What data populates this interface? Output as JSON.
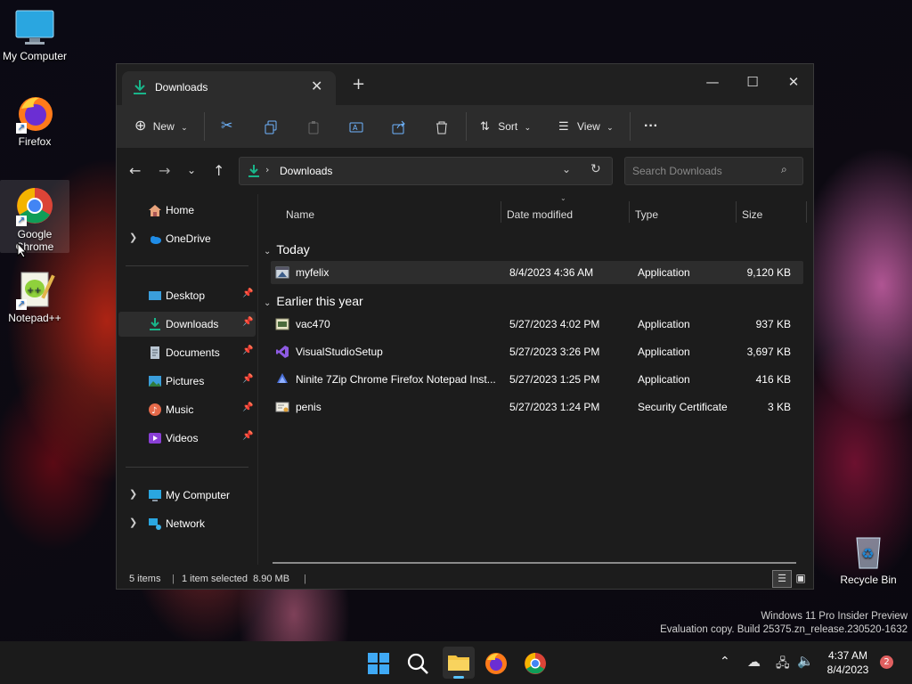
{
  "desktop": {
    "icons": [
      {
        "label": "My Computer"
      },
      {
        "label": "Firefox"
      },
      {
        "label": "Google Chrome"
      },
      {
        "label": "Notepad++"
      },
      {
        "label": "Recycle Bin"
      }
    ],
    "watermark_line1": "Windows 11 Pro Insider Preview",
    "watermark_line2": "Evaluation copy. Build 25375.zn_release.230520-1632"
  },
  "window": {
    "tab_title": "Downloads",
    "toolbar": {
      "new_label": "New",
      "sort_label": "Sort",
      "view_label": "View"
    },
    "address": {
      "path": "Downloads",
      "search_placeholder": "Search Downloads"
    },
    "sidebar": {
      "home": "Home",
      "onedrive": "OneDrive",
      "desktop": "Desktop",
      "downloads": "Downloads",
      "documents": "Documents",
      "pictures": "Pictures",
      "music": "Music",
      "videos": "Videos",
      "my_computer": "My Computer",
      "network": "Network"
    },
    "columns": {
      "name": "Name",
      "date": "Date modified",
      "type": "Type",
      "size": "Size"
    },
    "groups": {
      "today": "Today",
      "earlier": "Earlier this year"
    },
    "files": [
      {
        "name": "myfelix",
        "date": "8/4/2023 4:36 AM",
        "type": "Application",
        "size": "9,120 KB"
      },
      {
        "name": "vac470",
        "date": "5/27/2023 4:02 PM",
        "type": "Application",
        "size": "937 KB"
      },
      {
        "name": "VisualStudioSetup",
        "date": "5/27/2023 3:26 PM",
        "type": "Application",
        "size": "3,697 KB"
      },
      {
        "name": "Ninite 7Zip Chrome Firefox Notepad Inst...",
        "date": "5/27/2023 1:25 PM",
        "type": "Application",
        "size": "416 KB"
      },
      {
        "name": "penis",
        "date": "5/27/2023 1:24 PM",
        "type": "Security Certificate",
        "size": "3 KB"
      }
    ],
    "status": {
      "items": "5 items",
      "selected": "1 item selected  8.90 MB"
    }
  },
  "taskbar": {
    "time": "4:37 AM",
    "date": "8/4/2023",
    "notification_count": "2",
    "icons": [
      "start-icon",
      "search-icon",
      "file-explorer-icon",
      "firefox-icon",
      "chrome-icon"
    ]
  },
  "colors": {
    "accent": "#0f9d76",
    "window_bg": "#1c1c1c",
    "selected_row": "#2d2d2d"
  }
}
